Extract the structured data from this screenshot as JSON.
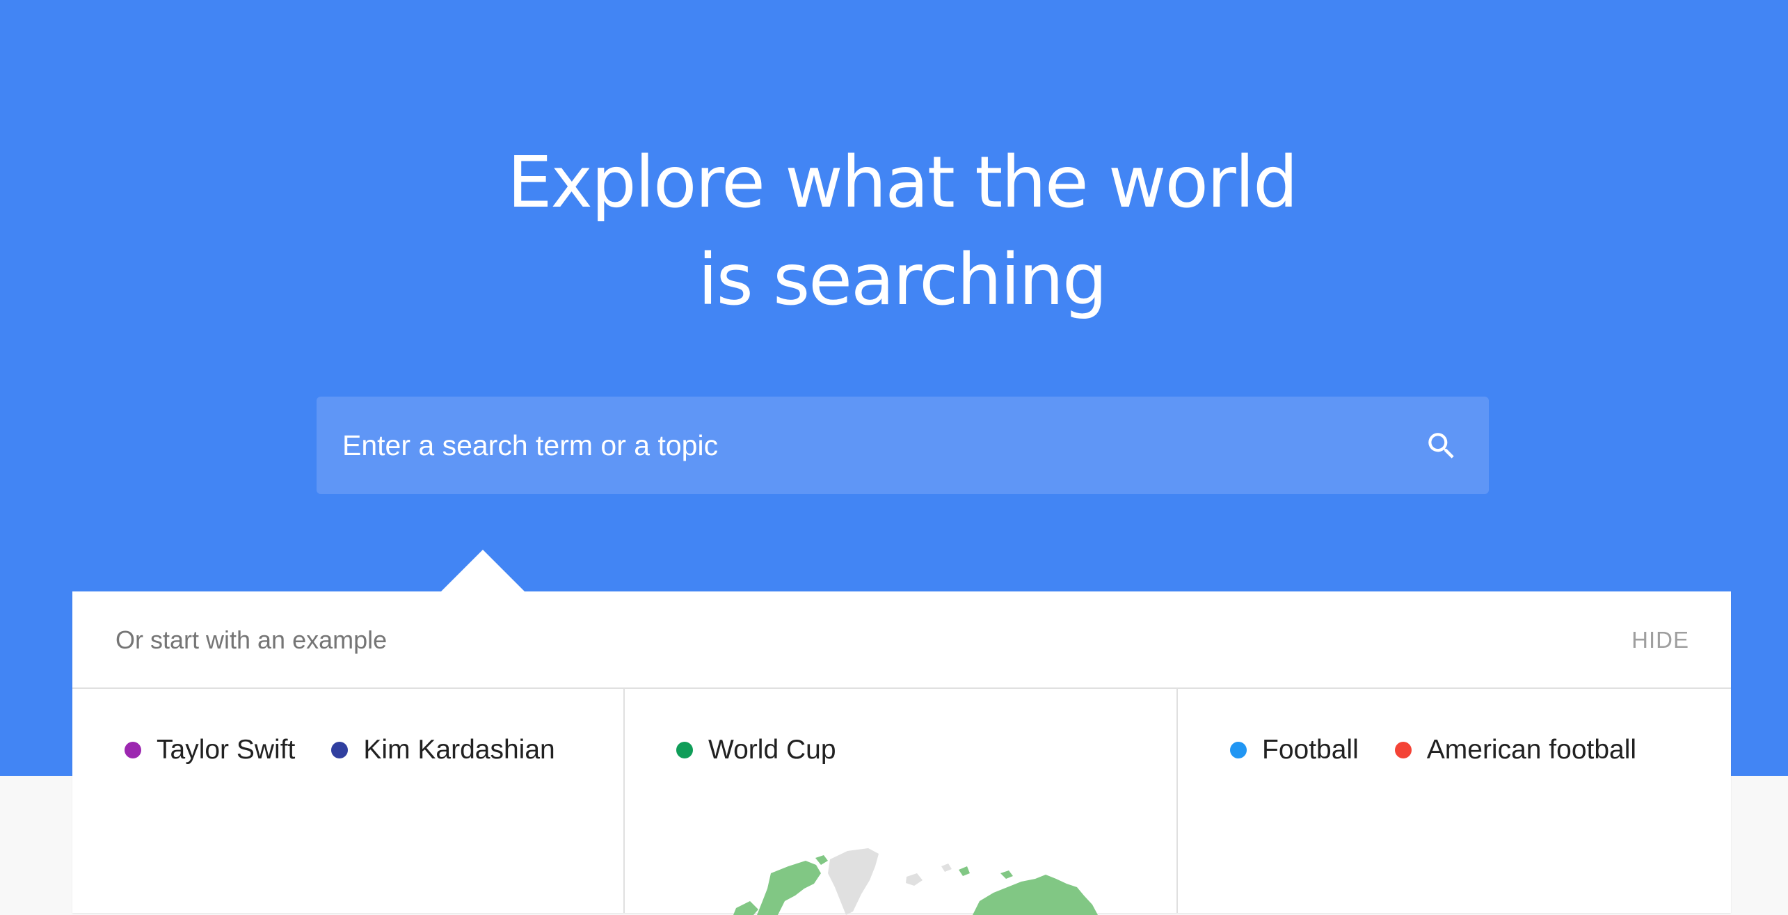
{
  "hero": {
    "title_line1": "Explore what the world",
    "title_line2": "is searching",
    "background_color": "#4285f4"
  },
  "search": {
    "placeholder": "Enter a search term or a topic",
    "icon": "search-icon"
  },
  "examples": {
    "title": "Or start with an example",
    "hide_label": "HIDE",
    "cards": [
      {
        "terms": [
          {
            "label": "Taylor Swift",
            "color": "#9c27b0"
          },
          {
            "label": "Kim Kardashian",
            "color": "#303f9f"
          }
        ]
      },
      {
        "terms": [
          {
            "label": "World Cup",
            "color": "#0f9d58"
          }
        ],
        "visual": "world-map"
      },
      {
        "terms": [
          {
            "label": "Football",
            "color": "#2196f3"
          },
          {
            "label": "American football",
            "color": "#f44336"
          }
        ]
      }
    ]
  }
}
